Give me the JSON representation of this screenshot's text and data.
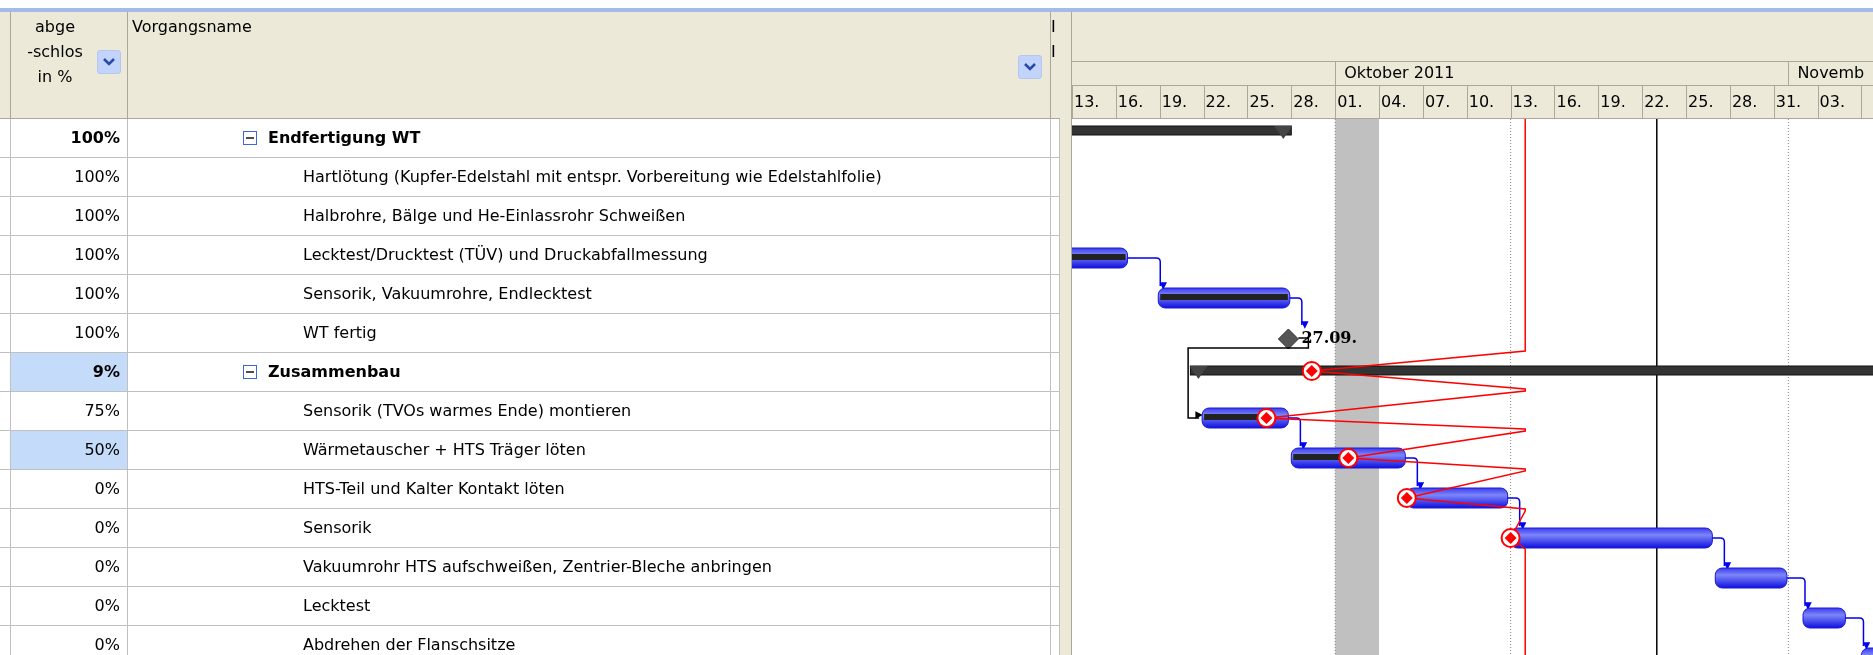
{
  "columns": [
    {
      "header_lines": [
        "abge",
        "-schlos",
        "in %"
      ],
      "filter": true
    },
    {
      "header_lines": [
        "Vorgangsname"
      ],
      "filter": true
    },
    {
      "header_lines": [
        "I",
        "I"
      ]
    }
  ],
  "timeline": {
    "months": [
      "Oktober 2011",
      "Novemb"
    ],
    "day_ticks": [
      "13.",
      "16.",
      "19.",
      "22.",
      "25.",
      "28.",
      "01.",
      "04.",
      "07.",
      "10.",
      "13.",
      "16.",
      "19.",
      "22.",
      "25.",
      "28.",
      "31.",
      "03."
    ]
  },
  "tasks": [
    {
      "percent": "100%",
      "name": "Endfertigung WT",
      "kind": "summary",
      "expanded": true,
      "selected": false,
      "children": [
        {
          "percent": "100%",
          "name": "Hartlötung (Kupfer-Edelstahl mit entspr. Vorbereitung wie Edelstahlfolie)",
          "kind": "task",
          "selected": false
        },
        {
          "percent": "100%",
          "name": "Halbrohre, Bälge und He-Einlassrohr Schweißen",
          "kind": "task",
          "selected": false
        },
        {
          "percent": "100%",
          "name": "Lecktest/Drucktest (TÜV) und Druckabfallmessung",
          "kind": "task",
          "selected": false
        },
        {
          "percent": "100%",
          "name": "Sensorik, Vakuumrohre, Endlecktest",
          "kind": "task",
          "selected": false
        },
        {
          "percent": "100%",
          "name": "WT fertig",
          "kind": "milestone",
          "selected": false,
          "milestone_label": "27.09."
        }
      ]
    },
    {
      "percent": "9%",
      "name": "Zusammenbau",
      "kind": "summary",
      "expanded": true,
      "selected": true,
      "children": [
        {
          "percent": "75%",
          "name": "Sensorik (TVOs warmes Ende) montieren",
          "kind": "task",
          "selected": false
        },
        {
          "percent": "50%",
          "name": "Wärmetauscher + HTS Träger löten",
          "kind": "task",
          "selected": true
        },
        {
          "percent": "0%",
          "name": "HTS-Teil und Kalter Kontakt löten",
          "kind": "task",
          "selected": false
        },
        {
          "percent": "0%",
          "name": "Sensorik",
          "kind": "task",
          "selected": false
        },
        {
          "percent": "0%",
          "name": "Vakuumrohr HTS aufschweißen, Zentrier-Bleche anbringen",
          "kind": "task",
          "selected": false
        },
        {
          "percent": "0%",
          "name": "Lecktest",
          "kind": "task",
          "selected": false
        },
        {
          "percent": "0%",
          "name": "Abdrehen der Flanschsitze",
          "kind": "task",
          "selected": false
        }
      ]
    }
  ]
}
